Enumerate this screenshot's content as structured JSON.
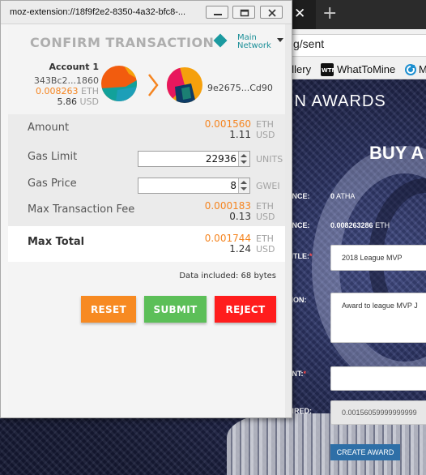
{
  "colors": {
    "accent_orange": "#f5841f",
    "network_teal": "#1b9aa0",
    "reset": "#f78a22",
    "submit": "#5cbf58",
    "reject": "#ff1d1d"
  },
  "browser": {
    "tab_close": "✕",
    "new_tab": "+",
    "url_fragment": "g/sent",
    "bookmarks": [
      {
        "label": "allery",
        "icon": ""
      },
      {
        "label": "WhatToMine",
        "icon": "wtm-icon"
      },
      {
        "label": "M",
        "icon": "refresh-icon"
      }
    ]
  },
  "page": {
    "heading": "IN AWARDS",
    "buy_heading": "BUY A",
    "fields": [
      {
        "label": "ANCE:",
        "value_bold": "0",
        "value": "ATHA",
        "required": false
      },
      {
        "label": "ANCE:",
        "value_bold": "0.008263286",
        "value": "ETH",
        "required": false
      },
      {
        "label": "TITLE:",
        "input": "2018 League MVP",
        "required": true
      },
      {
        "label": "TION:",
        "input": "Award to league MVP J",
        "required": false
      },
      {
        "label": "UNT:",
        "input": "",
        "required": true
      },
      {
        "label": "UIRED:",
        "input": "0.00156059999999999",
        "required": false
      }
    ],
    "create_button": "CREATE AWARD"
  },
  "popup": {
    "window_title": "moz-extension://18f9f2e2-8350-4a32-bfc8-...",
    "title": "CONFIRM TRANSACTION",
    "network_line1": "Main",
    "network_line2": "Network",
    "from": {
      "name": "Account 1",
      "address": "343Bc2...1860",
      "eth_value": "0.008263",
      "eth_unit": "ETH",
      "usd_value": "5.86",
      "usd_unit": "USD"
    },
    "to_address": "9e2675...Cd90",
    "amount": {
      "label": "Amount",
      "eth": "0.001560",
      "eth_unit": "ETH",
      "usd": "1.11",
      "usd_unit": "USD"
    },
    "gas_limit": {
      "label": "Gas Limit",
      "value": "22936",
      "unit": "UNITS"
    },
    "gas_price": {
      "label": "Gas Price",
      "value": "8",
      "unit": "GWEI"
    },
    "max_fee": {
      "label": "Max Transaction Fee",
      "eth": "0.000183",
      "eth_unit": "ETH",
      "usd": "0.13",
      "usd_unit": "USD"
    },
    "max_total": {
      "label": "Max Total",
      "eth": "0.001744",
      "eth_unit": "ETH",
      "usd": "1.24",
      "usd_unit": "USD"
    },
    "data_note": "Data included: 68 bytes",
    "buttons": {
      "reset": "RESET",
      "submit": "SUBMIT",
      "reject": "REJECT"
    }
  }
}
